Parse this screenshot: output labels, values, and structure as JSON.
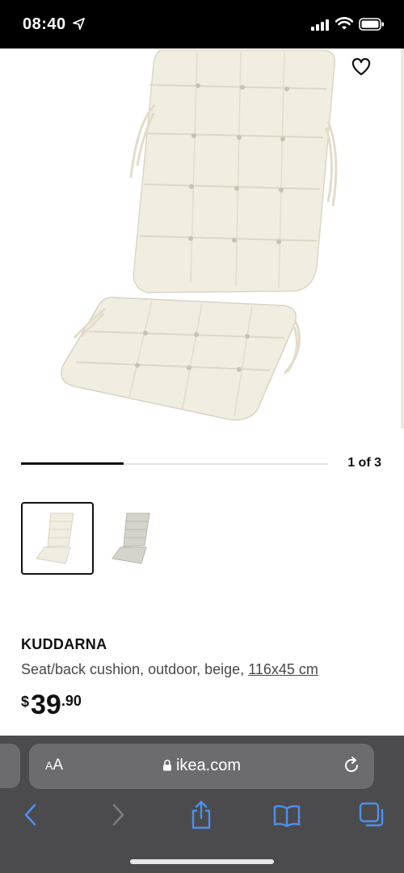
{
  "status_bar": {
    "time": "08:40"
  },
  "gallery": {
    "page_indicator": "1 of 3",
    "progress": 0.333,
    "active_index": 0,
    "thumbnail_count": 2
  },
  "product": {
    "name": "KUDDARNA",
    "description": "Seat/back cushion, outdoor, beige, ",
    "size": "116x45 cm",
    "price": {
      "currency": "$",
      "integer": "39",
      "decimal": ".90"
    }
  },
  "browser": {
    "text_size_button": {
      "small": "A",
      "large": "A"
    },
    "url": "ikea.com"
  },
  "colors": {
    "cushion": "#f1ede1",
    "cushion_alt": "#cfcbc3",
    "browser_chrome": "#4b4b4d",
    "link_blue": "#4e8ff1"
  },
  "icons": [
    "location-arrow-icon",
    "signal-icon",
    "wifi-icon",
    "battery-icon",
    "heart-icon",
    "lock-icon",
    "reload-icon",
    "back-icon",
    "forward-icon",
    "share-icon",
    "bookmarks-icon",
    "tabs-icon"
  ]
}
